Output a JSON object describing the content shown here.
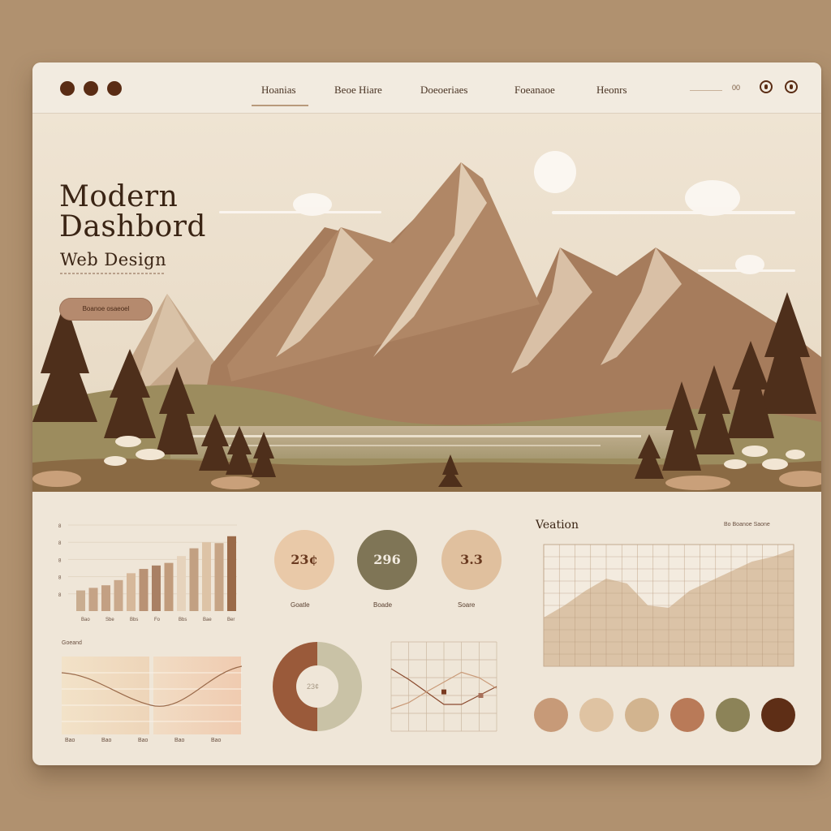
{
  "window": {
    "nav": [
      "Hoanias",
      "Beoe Hiare",
      "Doeoeriaes",
      "Foeanaoe",
      "Heonrs"
    ],
    "search_text": "",
    "nav_number": "00"
  },
  "hero": {
    "title_line1": "Modern",
    "title_line2": "Dashbord",
    "subtitle": "Web Design",
    "button_label": "Boanoe   osaeoel"
  },
  "bar_chart": {
    "tick_labels": [
      "8",
      "8",
      "8",
      "8",
      "8"
    ],
    "x_labels": [
      "Bao",
      "Sbe",
      "Bbs",
      "Fo",
      "Bbs",
      "Bae",
      "Ber"
    ]
  },
  "stats": [
    {
      "value": "23¢",
      "label": "Goatle",
      "color": "#e9c9a8",
      "text_color": "#6a3a20"
    },
    {
      "value": "296",
      "label": "Boade",
      "color": "#7f7556",
      "text_color": "#f2ebe0"
    },
    {
      "value": "3.3",
      "label": "Soare",
      "color": "#e0c09e",
      "text_color": "#6a3a20"
    }
  ],
  "area_panel": {
    "title": "Veation",
    "legend": "Bo Boanoe Saone"
  },
  "curve_panel": {
    "title": "Goeand",
    "x_labels": [
      "Bao",
      "Bao",
      "Bao",
      "Bao",
      "Bao"
    ]
  },
  "donut": {
    "center_label": "23¢"
  },
  "palette": [
    "#c79a78",
    "#dfc3a2",
    "#d2b48f",
    "#b97a58",
    "#8c8358",
    "#5e2e16"
  ],
  "chart_data": [
    {
      "type": "bar",
      "title": "",
      "categories": [
        "1",
        "2",
        "3",
        "4",
        "5",
        "6",
        "7",
        "8",
        "9",
        "10",
        "11",
        "12",
        "13"
      ],
      "values": [
        24,
        27,
        30,
        36,
        44,
        49,
        53,
        56,
        64,
        73,
        80,
        79,
        87
      ],
      "ylim": [
        0,
        100
      ]
    },
    {
      "type": "area",
      "title": "Veation",
      "x": [
        0,
        1,
        2,
        3,
        4,
        5,
        6,
        7,
        8,
        9,
        10,
        11,
        12
      ],
      "values": [
        40,
        50,
        62,
        72,
        68,
        50,
        48,
        62,
        70,
        78,
        86,
        90,
        96
      ],
      "ylim": [
        0,
        100
      ]
    },
    {
      "type": "line",
      "title": "",
      "series": [
        {
          "values": [
            70,
            58,
            44,
            30,
            30,
            40,
            50
          ]
        },
        {
          "values": [
            25,
            32,
            44,
            55,
            66,
            60,
            48
          ]
        }
      ]
    },
    {
      "type": "pie",
      "title": "",
      "values": [
        50,
        50
      ],
      "colors": [
        "#c9c2a6",
        "#9a5a3a"
      ]
    }
  ]
}
